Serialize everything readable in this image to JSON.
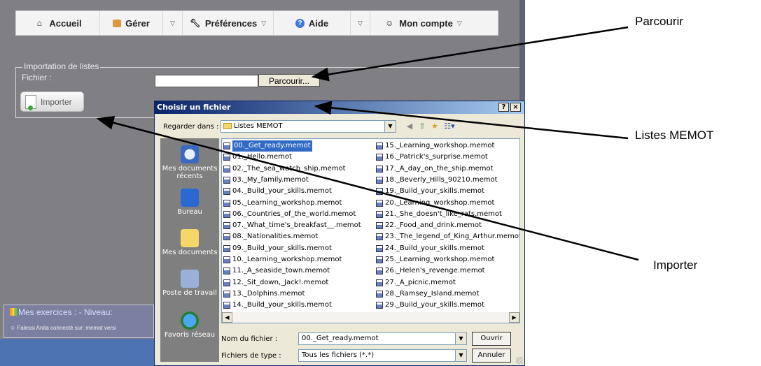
{
  "nav": {
    "items": [
      {
        "label": "Accueil",
        "icon": "home-icon"
      },
      {
        "label": "Gérer",
        "icon": "manage-icon"
      },
      {
        "label": "Préférences",
        "icon": "wrench-icon"
      },
      {
        "label": "Aide",
        "icon": "help-icon"
      },
      {
        "label": "Mon compte",
        "icon": "user-icon"
      }
    ],
    "dropdown_arrow": "▽"
  },
  "import_section": {
    "legend": "Importation de listes",
    "fichier_label": "Fichier :",
    "browse_button": "Parcourir...",
    "import_button": "Importer"
  },
  "status": {
    "title_main": "Mes exercices",
    "title_rest": ": - Niveau:",
    "connected_line": "Falessi Anita connecté sur: memot versi"
  },
  "dialog": {
    "title": "Choisir un fichier",
    "help_button": "?",
    "close_button": "×",
    "look_in_label": "Regarder dans :",
    "look_in_value": "Listes MEMOT",
    "places": [
      {
        "label": "Mes documents récents",
        "icon": "recent-documents-icon"
      },
      {
        "label": "Bureau",
        "icon": "desktop-icon"
      },
      {
        "label": "Mes documents",
        "icon": "my-documents-icon"
      },
      {
        "label": "Poste de travail",
        "icon": "computer-icon"
      },
      {
        "label": "Favoris réseau",
        "icon": "network-icon"
      }
    ],
    "files_col1": [
      "00._Get_ready.memot",
      "01._Hello.memot",
      "02._The_sea_watch_ship.memot",
      "03._My_family.memot",
      "04._Build_your_skills.memot",
      "05._Learning_workshop.memot",
      "06._Countries_of_the_world.memot",
      "07._What_time's_breakfast__.memot",
      "08._Nationalities.memot",
      "09._Build_your_skills.memot",
      "10._Learning_workshop.memot",
      "11._A_seaside_town.memot",
      "12._Sit_down,_Jack!.memot",
      "13._Dolphins.memot",
      "14._Build_your_skills.memot"
    ],
    "files_col2": [
      "15._Learning_workshop.memot",
      "16._Patrick's_surprise.memot",
      "17._A_day_on_the_ship.memot",
      "18._Beverly_Hills_90210.memot",
      "19._Build_your_skills.memot",
      "20._Learning_workshop.memot",
      "21._She_doesn't_like_rats.memot",
      "22._Food_and_drink.memot",
      "23._The_legend_of_King_Arthur.memot",
      "24._Build_your_skills.memot",
      "25._Learning_workshop.memot",
      "26._Helen's_revenge.memot",
      "27._A_picnic.memot",
      "28._Ramsey_Island.memot",
      "29._Build_your_skills.memot"
    ],
    "selected_file": "00._Get_ready.memot",
    "filename_label": "Nom du fichier :",
    "filename_value": "00._Get_ready.memot",
    "filetype_label": "Fichiers de type :",
    "filetype_value": "Tous les fichiers (*.*)",
    "open_button": "Ouvrir",
    "cancel_button": "Annuler"
  },
  "callouts": {
    "parcourir": "Parcourir",
    "listes_memot": "Listes MEMOT",
    "importer": "Importer"
  },
  "colors": {
    "app_background": "#7f7f84",
    "titlebar_start": "#0a246a",
    "selection": "#316ac5"
  }
}
